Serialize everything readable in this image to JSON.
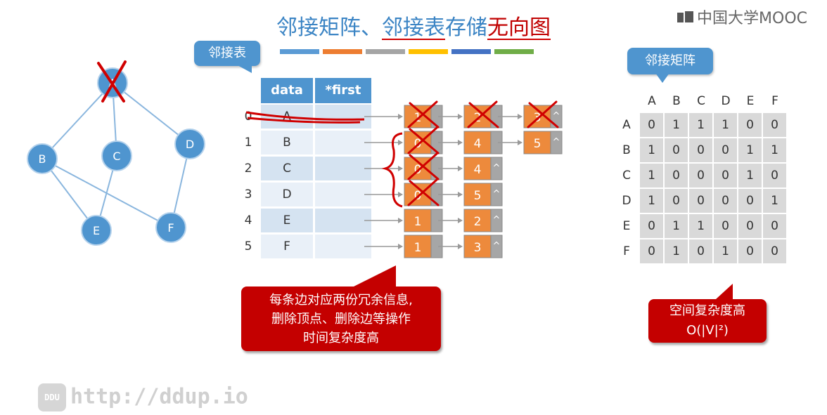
{
  "title": {
    "part1": "邻接矩阵、",
    "part2": "邻接表",
    "part3": "存储",
    "part4": "无向图"
  },
  "brand": "中国大学MOOC",
  "watermark": {
    "logo_text": "DDU",
    "text": "http://ddup.io"
  },
  "colors": {
    "accent": "#4f95cf",
    "cell_orange": "#ed8a3c",
    "cell_gray": "#a6a6a6",
    "warn_red": "#c40000",
    "bars": [
      "#5b9bd5",
      "#ed7d31",
      "#a5a5a5",
      "#ffc000",
      "#4472c4",
      "#70ad47"
    ]
  },
  "callouts": {
    "list": "邻接表",
    "matrix": "邻接矩阵"
  },
  "notes": {
    "list": [
      "每条边对应两份冗余信息,",
      "删除顶点、删除边等操作",
      "时间复杂度高"
    ],
    "matrix": [
      "空间复杂度高",
      "O(|V|²)"
    ]
  },
  "graph": {
    "nodes": [
      "A",
      "B",
      "C",
      "D",
      "E",
      "F"
    ],
    "edges": [
      [
        "A",
        "B"
      ],
      [
        "A",
        "C"
      ],
      [
        "A",
        "D"
      ],
      [
        "B",
        "E"
      ],
      [
        "B",
        "F"
      ],
      [
        "C",
        "E"
      ],
      [
        "D",
        "F"
      ]
    ],
    "deleted": [
      "A"
    ]
  },
  "adjlist": {
    "headers": {
      "data": "data",
      "first": "*first"
    },
    "rows": [
      {
        "idx": "0",
        "data": "A",
        "nodes": [
          {
            "v": "1",
            "null": false
          },
          {
            "v": "2",
            "null": false
          },
          {
            "v": "3",
            "null": true
          }
        ]
      },
      {
        "idx": "1",
        "data": "B",
        "nodes": [
          {
            "v": "0",
            "null": false
          },
          {
            "v": "4",
            "null": false
          },
          {
            "v": "5",
            "null": true
          }
        ]
      },
      {
        "idx": "2",
        "data": "C",
        "nodes": [
          {
            "v": "0",
            "null": false
          },
          {
            "v": "4",
            "null": true
          }
        ]
      },
      {
        "idx": "3",
        "data": "D",
        "nodes": [
          {
            "v": "0",
            "null": false
          },
          {
            "v": "5",
            "null": true
          }
        ]
      },
      {
        "idx": "4",
        "data": "E",
        "nodes": [
          {
            "v": "1",
            "null": false
          },
          {
            "v": "2",
            "null": true
          }
        ]
      },
      {
        "idx": "5",
        "data": "F",
        "nodes": [
          {
            "v": "1",
            "null": false
          },
          {
            "v": "3",
            "null": true
          }
        ]
      }
    ],
    "null_mark": "^"
  },
  "matrix": {
    "labels": [
      "A",
      "B",
      "C",
      "D",
      "E",
      "F"
    ],
    "values": [
      [
        "0",
        "1",
        "1",
        "1",
        "0",
        "0"
      ],
      [
        "1",
        "0",
        "0",
        "0",
        "1",
        "1"
      ],
      [
        "1",
        "0",
        "0",
        "0",
        "1",
        "0"
      ],
      [
        "1",
        "0",
        "0",
        "0",
        "0",
        "1"
      ],
      [
        "0",
        "1",
        "1",
        "0",
        "0",
        "0"
      ],
      [
        "0",
        "1",
        "0",
        "1",
        "0",
        "0"
      ]
    ]
  }
}
